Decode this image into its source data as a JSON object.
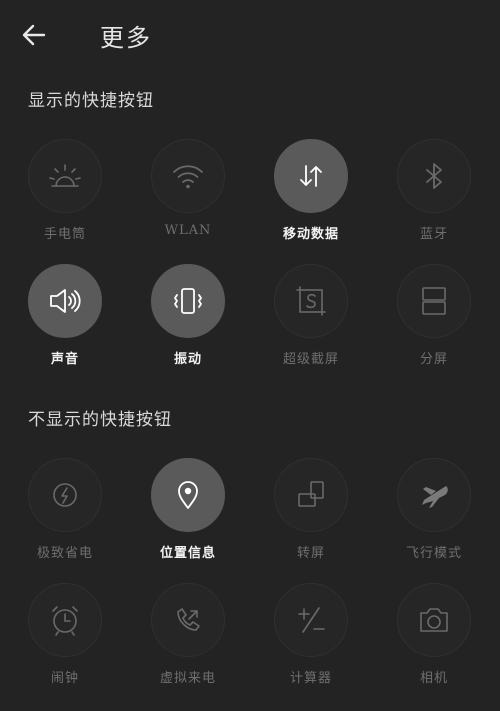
{
  "header": {
    "title": "更多"
  },
  "sections": {
    "shown_title": "显示的快捷按钮",
    "hidden_title": "不显示的快捷按钮"
  },
  "shown": [
    {
      "label": "手电筒",
      "icon": "flashlight-icon",
      "active": false
    },
    {
      "label": "WLAN",
      "icon": "wifi-icon",
      "active": false
    },
    {
      "label": "移动数据",
      "icon": "mobile-data-icon",
      "active": true
    },
    {
      "label": "蓝牙",
      "icon": "bluetooth-icon",
      "active": false
    },
    {
      "label": "声音",
      "icon": "sound-icon",
      "active": true
    },
    {
      "label": "振动",
      "icon": "vibrate-icon",
      "active": true
    },
    {
      "label": "超级截屏",
      "icon": "super-screenshot-icon",
      "active": false
    },
    {
      "label": "分屏",
      "icon": "split-screen-icon",
      "active": false
    }
  ],
  "hidden": [
    {
      "label": "极致省电",
      "icon": "power-saving-icon",
      "active": false
    },
    {
      "label": "位置信息",
      "icon": "location-icon",
      "active": true
    },
    {
      "label": "转屏",
      "icon": "rotate-screen-icon",
      "active": false
    },
    {
      "label": "飞行模式",
      "icon": "airplane-icon",
      "active": false
    },
    {
      "label": "闹钟",
      "icon": "alarm-icon",
      "active": false
    },
    {
      "label": "虚拟来电",
      "icon": "virtual-call-icon",
      "active": false
    },
    {
      "label": "计算器",
      "icon": "calculator-icon",
      "active": false
    },
    {
      "label": "相机",
      "icon": "camera-icon",
      "active": false
    }
  ],
  "colors": {
    "background": "#232323",
    "active_circle": "#5a5a5a",
    "inactive_label": "#6f6f6f",
    "active_label": "#f2f2f2"
  }
}
